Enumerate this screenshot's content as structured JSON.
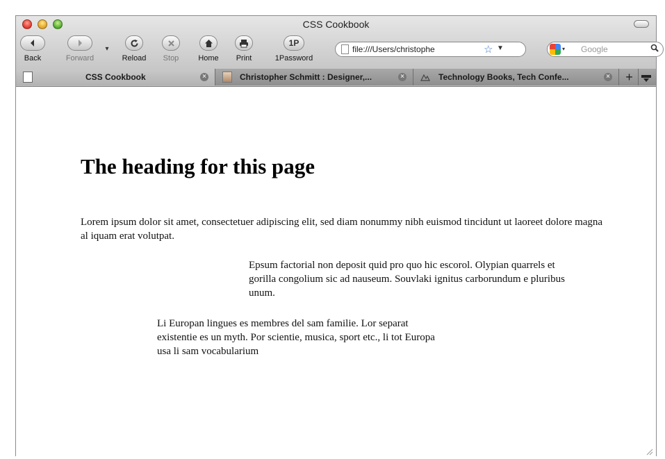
{
  "window": {
    "title": "CSS Cookbook"
  },
  "toolbar": {
    "back": "Back",
    "forward": "Forward",
    "reload": "Reload",
    "stop": "Stop",
    "home": "Home",
    "print": "Print",
    "onepassword_badge": "1P",
    "onepassword": "1Password"
  },
  "address": {
    "url": "file:///Users/christophe"
  },
  "search": {
    "placeholder": "Google"
  },
  "tabs": [
    {
      "label": "CSS Cookbook"
    },
    {
      "label": "Christopher Schmitt : Designer,..."
    },
    {
      "label": "Technology Books, Tech Confe..."
    }
  ],
  "page": {
    "heading": "The heading for this page",
    "paragraphs": [
      "Lorem ipsum dolor sit amet, consectetuer adipiscing elit, sed diam nonummy nibh euismod tincidunt ut laoreet dolore magna al iquam erat volutpat.",
      "Epsum factorial non deposit quid pro quo hic escorol. Olypian quarrels et gorilla congolium sic ad nauseum. Souvlaki ignitus carborundum e pluribus unum.",
      "Li Europan lingues es membres del sam familie. Lor separat existentie es un myth. Por scientie, musica, sport etc., li tot Europa usa li sam vocabularium"
    ]
  }
}
